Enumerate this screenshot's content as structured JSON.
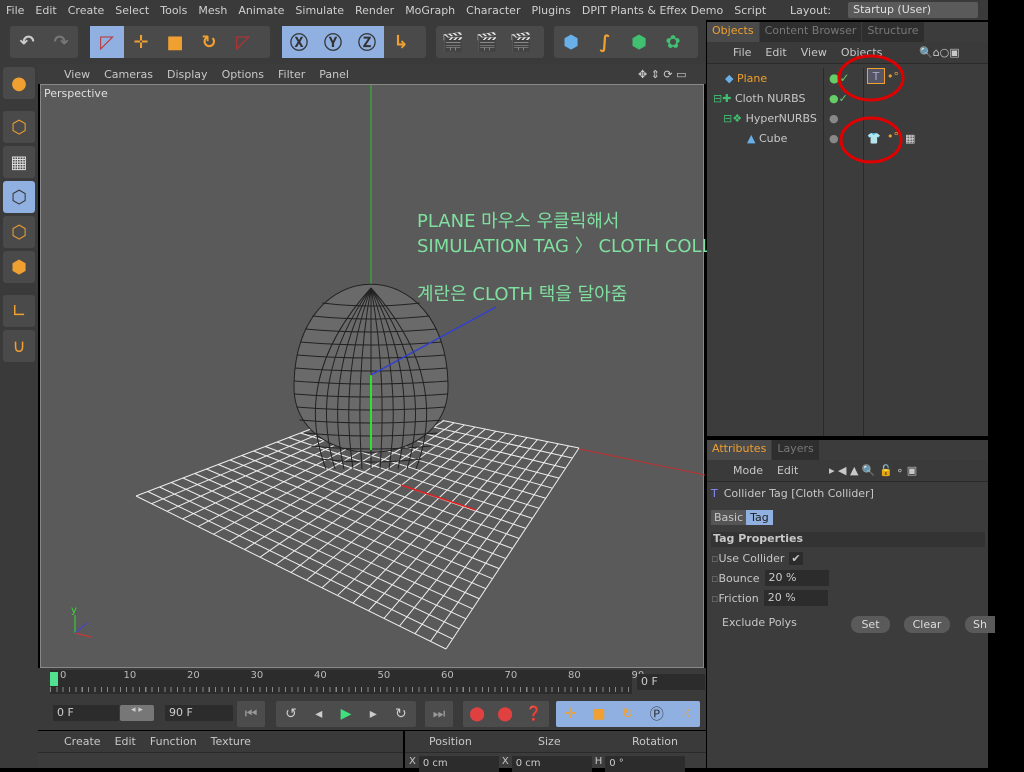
{
  "menu": [
    "File",
    "Edit",
    "Create",
    "Select",
    "Tools",
    "Mesh",
    "Animate",
    "Simulate",
    "Render",
    "MoGraph",
    "Character",
    "Plugins",
    "DPIT Plants & Effex Demo",
    "Script"
  ],
  "layout": {
    "label": "Layout:",
    "value": "Startup (User)"
  },
  "viewport": {
    "menu": [
      "View",
      "Cameras",
      "Display",
      "Options",
      "Filter",
      "Panel"
    ],
    "label": "Perspective",
    "notes": [
      "PLANE 마우스 우클릭해서",
      "SIMULATION TAG 〉 CLOTH COLLIDER",
      "계란은 CLOTH 택을 달아줌"
    ]
  },
  "objects": {
    "tabs": [
      "Objects",
      "Content Browser",
      "Structure"
    ],
    "menu": [
      "File",
      "Edit",
      "View",
      "Objects"
    ],
    "items": [
      {
        "name": "Plane",
        "active": true
      },
      {
        "name": "Cloth NURBS"
      },
      {
        "name": "HyperNURBS"
      },
      {
        "name": "Cube"
      }
    ]
  },
  "attributes": {
    "tabs": [
      "Attributes",
      "Layers"
    ],
    "menu": [
      "Mode",
      "Edit"
    ],
    "title": "Collider Tag [Cloth Collider]",
    "subtabs": [
      "Basic",
      "Tag"
    ],
    "section": "Tag Properties",
    "use_collider": "Use Collider",
    "use_collider_checked": true,
    "bounce_label": "Bounce",
    "bounce": "20 %",
    "friction_label": "Friction",
    "friction": "20 %",
    "exclude": "Exclude Polys",
    "buttons": [
      "Set",
      "Clear",
      "Sh"
    ]
  },
  "timeline": {
    "ticks": [
      "0",
      "10",
      "20",
      "30",
      "40",
      "50",
      "60",
      "70",
      "80",
      "90"
    ],
    "current": "0 F",
    "start": "0 F",
    "end": "90 F"
  },
  "materials": {
    "menu": [
      "Create",
      "Edit",
      "Function",
      "Texture"
    ]
  },
  "coords": {
    "headers": [
      "Position",
      "Size",
      "Rotation"
    ],
    "x_pos": "0 cm",
    "x_size": "0 cm",
    "h_rot": "0 °"
  },
  "colors": {
    "accent": "#f0a030",
    "note": "#7fe0a0",
    "annotation": "#e00000"
  }
}
